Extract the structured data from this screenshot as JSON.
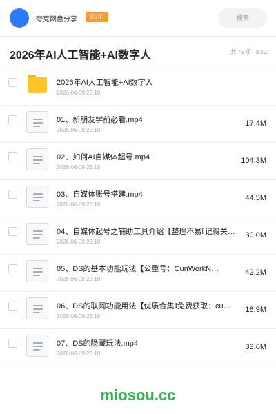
{
  "header": {
    "username": "夸克网盘分享",
    "badge": "SVIP",
    "search_placeholder": "搜索",
    "accent_color": "#2c7bff",
    "badge_color": "#ff9a2e"
  },
  "folder": {
    "title": "2026年AI人工智能+AI数字人",
    "meta": "共 75 项 · 3.5G"
  },
  "items": [
    {
      "type": "folder",
      "name": "2026年AI人工智能+AI数字人",
      "date": "2026-06-09 23:18",
      "size": ""
    },
    {
      "type": "video",
      "name": "01、新朋友学前必看.mp4",
      "date": "2026-06-09 23:18",
      "size": "17.4M"
    },
    {
      "type": "video",
      "name": "02、如何AI自媒体起号.mp4",
      "date": "2026-06-09 23:18",
      "size": "104.3M"
    },
    {
      "type": "video",
      "name": "03、自媒体账号搭建.mp4",
      "date": "2026-06-09 23:18",
      "size": "44.5M"
    },
    {
      "type": "video",
      "name": "04、自媒体起号之辅助工具介绍【整理不易‖记得关注…",
      "date": "2026-06-09 23:18",
      "size": "30.0M"
    },
    {
      "type": "video",
      "name": "05、DS的基本功能玩法【公重号：CunWorkN…",
      "date": "2026-06-09 23:18",
      "size": "42.2M"
    },
    {
      "type": "video",
      "name": "06、DS的联网功能用法【优质合集‖免费获取：cu…",
      "date": "2026-06-09 23:18",
      "size": "18.9M"
    },
    {
      "type": "video",
      "name": "07、DS的隐藏玩法.mp4",
      "date": "2026-06-09 23:18",
      "size": "33.6M"
    }
  ],
  "footer": {
    "watermark": "miosou.cc",
    "color": "#2fb34a"
  }
}
